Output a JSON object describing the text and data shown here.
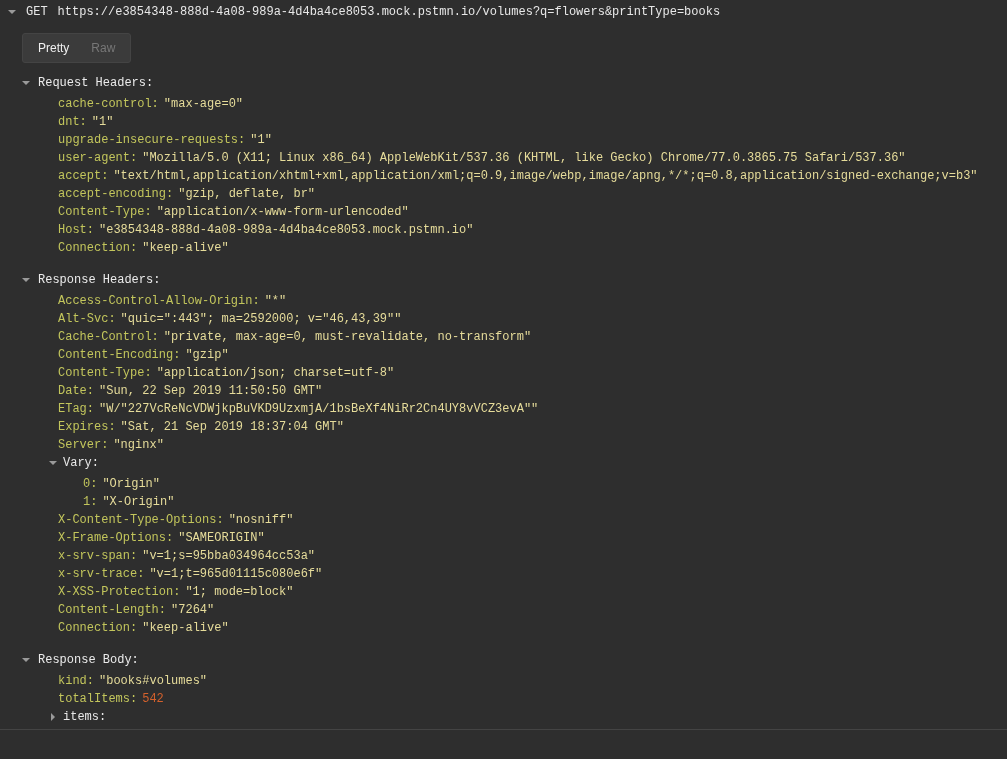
{
  "request": {
    "method": "GET",
    "url": "https://e3854348-888d-4a08-989a-4d4ba4ce8053.mock.pstmn.io/volumes?q=flowers&printType=books",
    "expanded": true
  },
  "view_toggle": [
    {
      "label": "Pretty",
      "selected": true
    },
    {
      "label": "Raw",
      "selected": false
    }
  ],
  "sections": [
    {
      "title": "Request Headers:",
      "expanded": true,
      "entries": [
        {
          "kind": "string",
          "key": "cache-control:",
          "value": "\"max-age=0\""
        },
        {
          "kind": "string",
          "key": "dnt:",
          "value": "\"1\""
        },
        {
          "kind": "string",
          "key": "upgrade-insecure-requests:",
          "value": "\"1\""
        },
        {
          "kind": "string",
          "key": "user-agent:",
          "value": "\"Mozilla/5.0 (X11; Linux x86_64) AppleWebKit/537.36 (KHTML, like Gecko) Chrome/77.0.3865.75 Safari/537.36\""
        },
        {
          "kind": "string",
          "key": "accept:",
          "value": "\"text/html,application/xhtml+xml,application/xml;q=0.9,image/webp,image/apng,*/*;q=0.8,application/signed-exchange;v=b3\""
        },
        {
          "kind": "string",
          "key": "accept-encoding:",
          "value": "\"gzip, deflate, br\""
        },
        {
          "kind": "string",
          "key": "Content-Type:",
          "value": "\"application/x-www-form-urlencoded\""
        },
        {
          "kind": "string",
          "key": "Host:",
          "value": "\"e3854348-888d-4a08-989a-4d4ba4ce8053.mock.pstmn.io\""
        },
        {
          "kind": "string",
          "key": "Connection:",
          "value": "\"keep-alive\""
        }
      ]
    },
    {
      "title": "Response Headers:",
      "expanded": true,
      "entries": [
        {
          "kind": "string",
          "key": "Access-Control-Allow-Origin:",
          "value": "\"*\""
        },
        {
          "kind": "string",
          "key": "Alt-Svc:",
          "value": "\"quic=\":443\"; ma=2592000; v=\"46,43,39\"\""
        },
        {
          "kind": "string",
          "key": "Cache-Control:",
          "value": "\"private, max-age=0, must-revalidate, no-transform\""
        },
        {
          "kind": "string",
          "key": "Content-Encoding:",
          "value": "\"gzip\""
        },
        {
          "kind": "string",
          "key": "Content-Type:",
          "value": "\"application/json; charset=utf-8\""
        },
        {
          "kind": "string",
          "key": "Date:",
          "value": "\"Sun, 22 Sep 2019 11:50:50 GMT\""
        },
        {
          "kind": "string",
          "key": "ETag:",
          "value": "\"W/\"227VcReNcVDWjkpBuVKD9UzxmjA/1bsBeXf4NiRr2Cn4UY8vVCZ3evA\"\""
        },
        {
          "kind": "string",
          "key": "Expires:",
          "value": "\"Sat, 21 Sep 2019 18:37:04 GMT\""
        },
        {
          "kind": "string",
          "key": "Server:",
          "value": "\"nginx\""
        },
        {
          "kind": "group",
          "key": "Vary:",
          "expanded": true,
          "children": [
            {
              "kind": "string",
              "key": "0:",
              "value": "\"Origin\""
            },
            {
              "kind": "string",
              "key": "1:",
              "value": "\"X-Origin\""
            }
          ]
        },
        {
          "kind": "string",
          "key": "X-Content-Type-Options:",
          "value": "\"nosniff\""
        },
        {
          "kind": "string",
          "key": "X-Frame-Options:",
          "value": "\"SAMEORIGIN\""
        },
        {
          "kind": "string",
          "key": "x-srv-span:",
          "value": "\"v=1;s=95bba034964cc53a\""
        },
        {
          "kind": "string",
          "key": "x-srv-trace:",
          "value": "\"v=1;t=965d01115c080e6f\""
        },
        {
          "kind": "string",
          "key": "X-XSS-Protection:",
          "value": "\"1; mode=block\""
        },
        {
          "kind": "string",
          "key": "Content-Length:",
          "value": "\"7264\""
        },
        {
          "kind": "string",
          "key": "Connection:",
          "value": "\"keep-alive\""
        }
      ]
    },
    {
      "title": "Response Body:",
      "expanded": true,
      "entries": [
        {
          "kind": "string",
          "key": "kind:",
          "value": "\"books#volumes\""
        },
        {
          "kind": "number",
          "key": "totalItems:",
          "value": "542"
        },
        {
          "kind": "group",
          "key": "items:",
          "expanded": false
        }
      ]
    }
  ]
}
